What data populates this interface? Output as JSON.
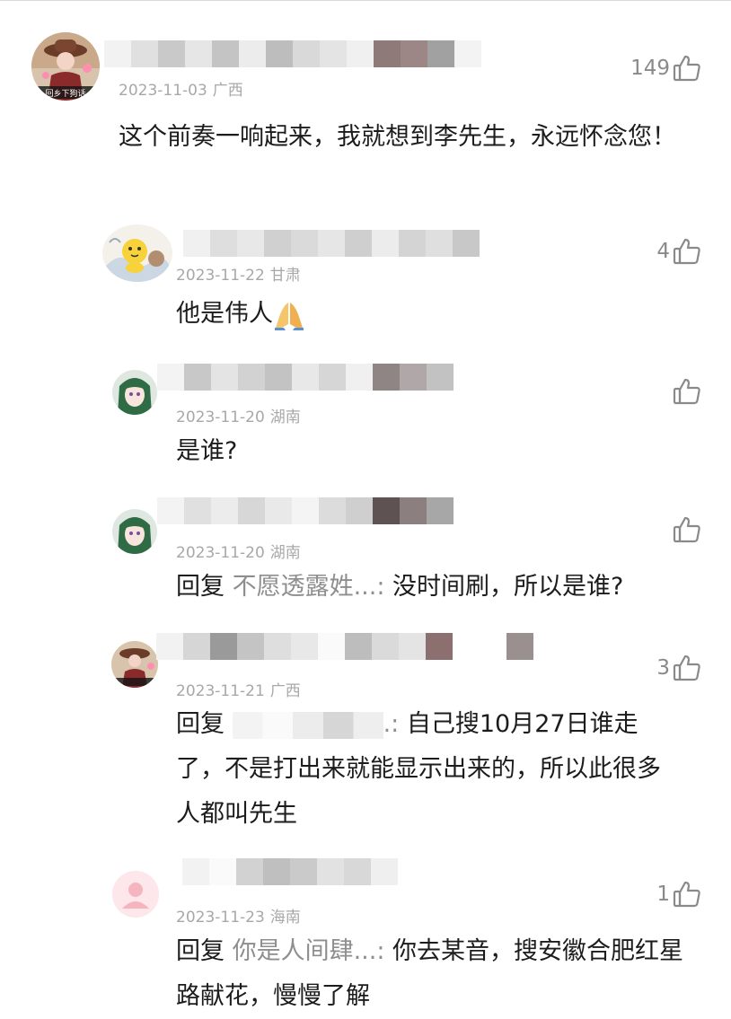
{
  "comments": [
    {
      "date": "2023-11-03",
      "region": "广西",
      "likes": "149",
      "text": "这个前奏一响起来，我就想到李先生，永远怀念您！",
      "avatar_caption": "回乡下狗话"
    },
    {
      "date": "2023-11-22",
      "region": "甘肃",
      "likes": "4",
      "text": "他是伟人"
    },
    {
      "date": "2023-11-20",
      "region": "湖南",
      "likes": "",
      "text": "是谁?"
    },
    {
      "date": "2023-11-20",
      "region": "湖南",
      "likes": "",
      "reply_prefix": "回复",
      "mention": "不愿透露姓...:",
      "text": " 没时间刷，所以是谁?"
    },
    {
      "date": "2023-11-21",
      "region": "广西",
      "likes": "3",
      "reply_prefix": "回复",
      "mention_tail": ".:",
      "text_line1": " 自己搜10月27日谁走",
      "text_rest": "了，不是打出来就能显示出来的，所以此很多人都叫先生"
    },
    {
      "date": "2023-11-23",
      "region": "海南",
      "likes": "1",
      "reply_prefix": "回复",
      "mention": "你是人间肆...:",
      "text": " 你去某音，搜安徽合肥红星路献花，慢慢了解"
    }
  ]
}
